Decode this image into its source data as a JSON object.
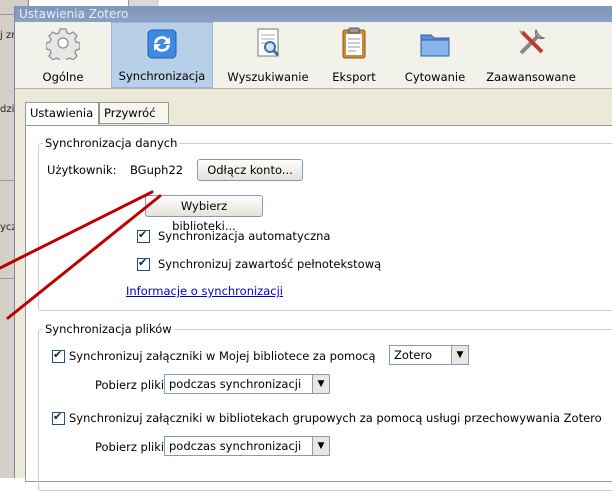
{
  "window": {
    "title": "Ustawienia Zotero"
  },
  "background_window": {
    "fragments": [
      "j zr",
      "dzic",
      "ycz"
    ]
  },
  "toolbar": {
    "items": [
      {
        "label": "Ogólne",
        "icon": "gear-icon"
      },
      {
        "label": "Synchronizacja",
        "icon": "sync-icon",
        "selected": true
      },
      {
        "label": "Wyszukiwanie",
        "icon": "search-document-icon"
      },
      {
        "label": "Eksport",
        "icon": "clipboard-icon"
      },
      {
        "label": "Cytowanie",
        "icon": "folder-icon"
      },
      {
        "label": "Zaawansowane",
        "icon": "tools-icon"
      }
    ]
  },
  "tabs": [
    {
      "label": "Ustawienia",
      "active": true
    },
    {
      "label": "Przywróć",
      "active": false
    }
  ],
  "data_sync": {
    "legend": "Synchronizacja danych",
    "user_label": "Użytkownik:",
    "username": "BGuph22",
    "unlink_button": "Odłącz konto...",
    "choose_libraries_button": "Wybierz biblioteki...",
    "auto_sync_label": "Synchronizacja automatyczna",
    "auto_sync_checked": true,
    "fulltext_sync_label": "Synchronizuj zawartość pełnotekstową",
    "fulltext_sync_checked": true,
    "info_link": "Informacje o synchronizacji"
  },
  "file_sync": {
    "legend": "Synchronizacja plików",
    "my_library_label": "Synchronizuj załączniki w Mojej bibliotece za pomocą",
    "my_library_checked": true,
    "my_library_service": "Zotero",
    "download_label_1": "Pobierz pliki",
    "download_value_1": "podczas synchronizacji",
    "group_label": "Synchronizuj załączniki w bibliotekach grupowych za pomocą usługi przechowywania Zotero",
    "group_checked": true,
    "download_label_2": "Pobierz pliki",
    "download_value_2": "podczas synchronizacji"
  },
  "annotation": {
    "color": "#c00000"
  }
}
